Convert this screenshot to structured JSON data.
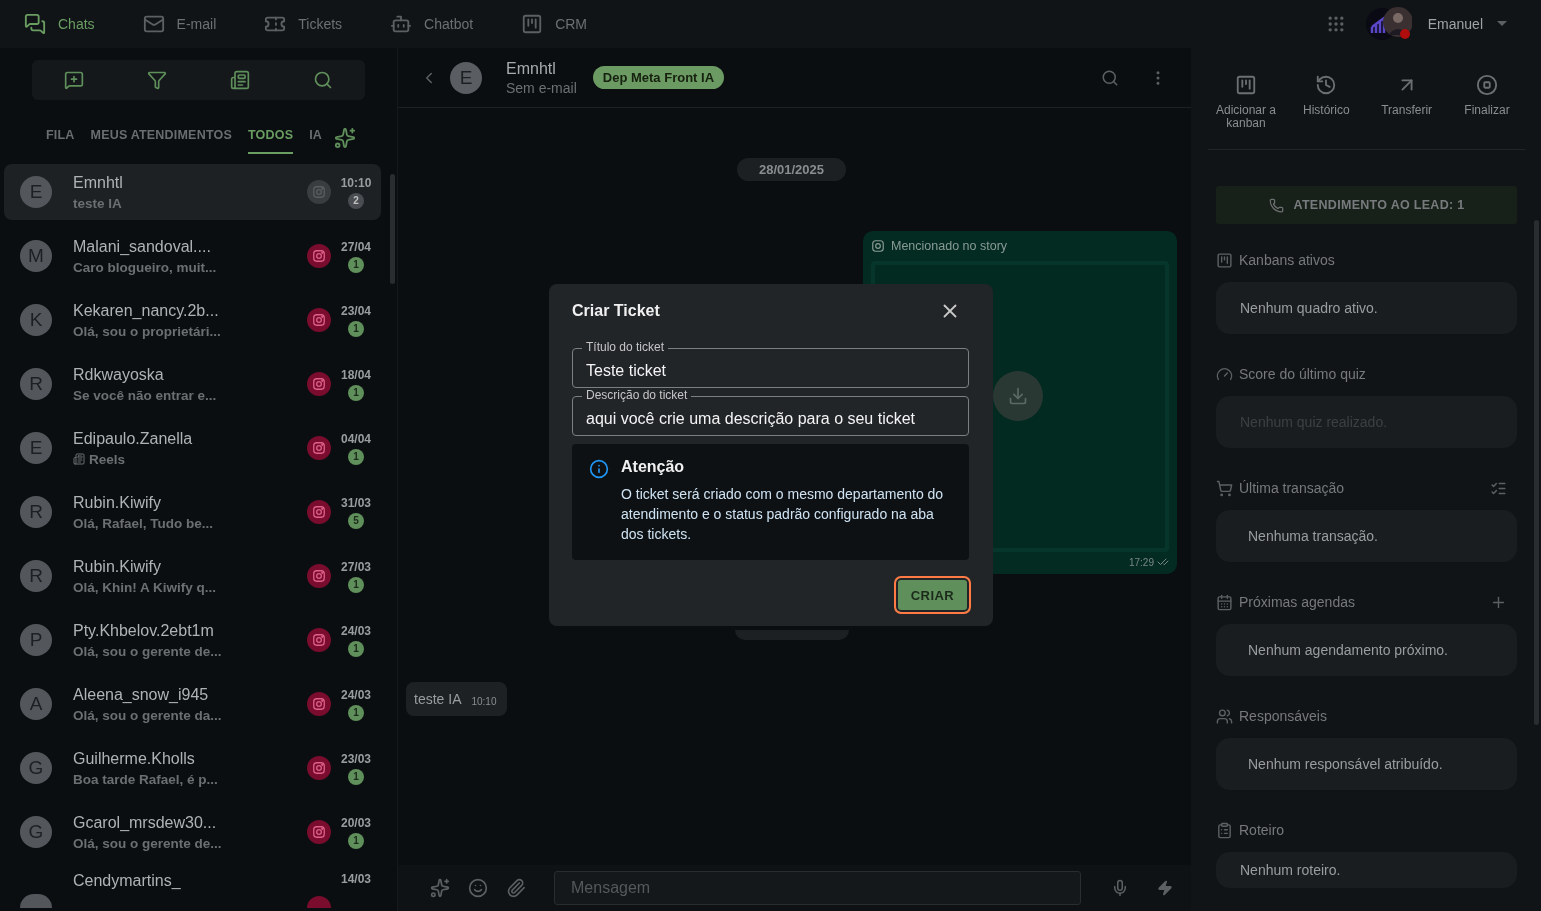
{
  "nav": {
    "items": [
      {
        "label": "Chats",
        "selected": true
      },
      {
        "label": "E-mail",
        "selected": false
      },
      {
        "label": "Tickets",
        "selected": false
      },
      {
        "label": "Chatbot",
        "selected": false
      },
      {
        "label": "CRM",
        "selected": false
      }
    ],
    "user": {
      "name": "Emanuel",
      "online": false
    }
  },
  "sidebar": {
    "tabs": [
      {
        "label": "FILA",
        "selected": false
      },
      {
        "label": "MEUS ATENDIMENTOS",
        "selected": false
      },
      {
        "label": "TODOS",
        "selected": true
      },
      {
        "label": "IA",
        "selected": false
      }
    ],
    "chats": [
      {
        "initial": "E",
        "name": "Emnhtl",
        "preview": "teste IA",
        "kind": "text",
        "time": "10:10",
        "unread": "2",
        "selected": true
      },
      {
        "initial": "M",
        "name": "Malani_sandoval....",
        "preview": "Caro blogueiro, muit...",
        "kind": "text",
        "time": "27/04",
        "unread": "1",
        "selected": false
      },
      {
        "initial": "K",
        "name": "Kekaren_nancy.2b...",
        "preview": "Olá, sou o proprietári...",
        "kind": "text",
        "time": "23/04",
        "unread": "1",
        "selected": false
      },
      {
        "initial": "R",
        "name": "Rdkwayoska",
        "preview": "Se você não entrar e...",
        "kind": "text",
        "time": "18/04",
        "unread": "1",
        "selected": false
      },
      {
        "initial": "E",
        "name": "Edipaulo.Zanella",
        "preview": "Reels",
        "kind": "media",
        "time": "04/04",
        "unread": "1",
        "selected": false
      },
      {
        "initial": "R",
        "name": "Rubin.Kiwify",
        "preview": "Olá, Rafael, Tudo be...",
        "kind": "text",
        "time": "31/03",
        "unread": "5",
        "selected": false
      },
      {
        "initial": "R",
        "name": "Rubin.Kiwify",
        "preview": "Olá, Khin! A Kiwify q...",
        "kind": "text",
        "time": "27/03",
        "unread": "1",
        "selected": false
      },
      {
        "initial": "P",
        "name": "Pty.Khbelov.2ebt1m",
        "preview": "Olá, sou o gerente de...",
        "kind": "text",
        "time": "24/03",
        "unread": "1",
        "selected": false
      },
      {
        "initial": "A",
        "name": "Aleena_snow_i945",
        "preview": "Olá, sou o gerente da...",
        "kind": "text",
        "time": "24/03",
        "unread": "1",
        "selected": false
      },
      {
        "initial": "G",
        "name": "Guilherme.Kholls",
        "preview": "Boa tarde Rafael, é p...",
        "kind": "text",
        "time": "23/03",
        "unread": "1",
        "selected": false
      },
      {
        "initial": "G",
        "name": "Gcarol_mrsdew30...",
        "preview": "Olá, sou o gerente de...",
        "kind": "text",
        "time": "20/03",
        "unread": "1",
        "selected": false
      },
      {
        "name": "Cendymartins_",
        "kind": "partial",
        "time": "14/03",
        "selected": false
      }
    ]
  },
  "conversation": {
    "contact": {
      "initial": "E",
      "name": "Emnhtl",
      "subtitle": "Sem e-mail",
      "tag": "Dep Meta Front IA"
    },
    "date_chip": "28/01/2025",
    "messages": [
      {
        "kind": "story",
        "caption": "Mencionado no story",
        "time": "17:29"
      },
      {
        "kind": "text",
        "text": "teste IA",
        "time": "10:10"
      }
    ],
    "composer": {
      "placeholder": "Mensagem"
    }
  },
  "details": {
    "actions": [
      "Adicionar a kanban",
      "Histórico",
      "Transferir",
      "Finalizar"
    ],
    "lead_button": "ATENDIMENTO AO LEAD: 1",
    "sections": [
      {
        "title": "Kanbans ativos",
        "empty": "Nenhum quadro ativo.",
        "disabled": false
      },
      {
        "title": "Score do último quiz",
        "empty": "Nenhum quiz realizado.",
        "disabled": true
      },
      {
        "title": "Última transação",
        "empty": "Nenhuma transação.",
        "disabled": false
      },
      {
        "title": "Próximas agendas",
        "empty": "Nenhum agendamento próximo.",
        "disabled": false
      },
      {
        "title": "Responsáveis",
        "empty": "Nenhum responsável atribuído.",
        "disabled": false
      },
      {
        "title": "Roteiro",
        "empty": "Nenhum roteiro.",
        "disabled": false
      }
    ]
  },
  "dialog": {
    "title": "Criar Ticket",
    "fields": [
      {
        "label": "Título do ticket",
        "value": "Teste ticket"
      },
      {
        "label": "Descrição do ticket",
        "value": "aqui você crie uma descrição para o seu ticket"
      }
    ],
    "alert": {
      "title": "Atenção",
      "text": "O ticket será criado com o mesmo departamento do atendimento e o status padrão configurado na aba dos tickets."
    },
    "submit": "CRIAR"
  }
}
